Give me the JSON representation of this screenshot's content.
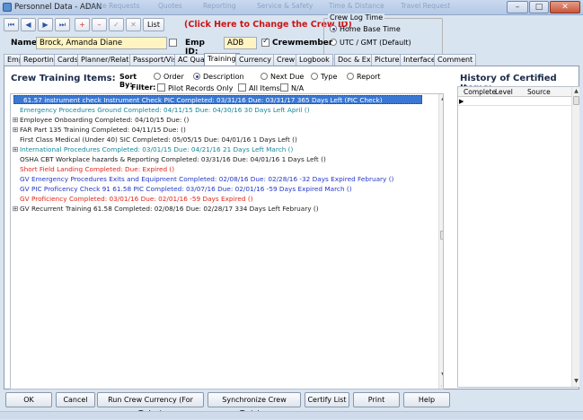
{
  "window": {
    "title": "Personnel Data - ADAN",
    "background_tabs": [
      "Quote Requests",
      "Quotes",
      "Reporting",
      "Service & Safety",
      "Time & Distance",
      "Travel Request"
    ],
    "controls": {
      "minimize": "–",
      "maximize": "□",
      "close": "✕"
    }
  },
  "toolbar": {
    "buttons": [
      {
        "icon": "first-record-icon",
        "glyph": "⏮"
      },
      {
        "icon": "prev-record-icon",
        "glyph": "◀"
      },
      {
        "icon": "next-record-icon",
        "glyph": "▶"
      },
      {
        "icon": "last-record-icon",
        "glyph": "⏭"
      },
      {
        "icon": "add-record-icon",
        "glyph": "+"
      },
      {
        "icon": "delete-record-icon",
        "glyph": "–"
      },
      {
        "icon": "save-record-icon",
        "glyph": "✓"
      },
      {
        "icon": "cancel-edit-icon",
        "glyph": "✕"
      }
    ],
    "list_label": "List",
    "crew_link": "(Click Here to Change the Crew ID)"
  },
  "crew_log_time": {
    "legend": "Crew Log Time",
    "options": [
      "Home Base Time",
      "UTC / GMT (Default)"
    ],
    "selected": 0
  },
  "person": {
    "name_label": "Name:",
    "name_value": "Brock, Amanda Diane",
    "emp_id_label": "Emp ID:",
    "emp_id_value": "ADB",
    "crewmember_label": "Crewmember",
    "crewmember_checked": true
  },
  "tabs": [
    "Emp",
    "Reporting",
    "Cards",
    "Planner/Relatives",
    "Passport/Visa",
    "AC Qual",
    "Training",
    "Currency",
    "Crew",
    "Logbook",
    "Doc & Exp",
    "Picture",
    "Interface",
    "Comment"
  ],
  "active_tab": "Training",
  "training": {
    "title": "Crew Training Items:",
    "sort_by_label": "Sort By:",
    "sort_options": [
      "Order",
      "Description",
      "Next Due",
      "Type",
      "Report"
    ],
    "sort_selected": 1,
    "filter_label": "Filter:",
    "filter_options": [
      "Pilot Records Only",
      "All Items",
      "N/A"
    ],
    "items": [
      {
        "text": "61.57 instrument check  Instrument Check  PIC  Completed: 03/31/16  Due: 03/31/17  365 Days Left      (PIC Check)",
        "color": "selected",
        "expandable": false
      },
      {
        "text": "Emergency Procedures Ground     Completed: 04/11/15  Due: 04/30/16  30 Days Left  April   ()",
        "color": "teal",
        "expandable": false
      },
      {
        "text": "Employee Onboarding    Completed: 04/10/15  Due:         ()",
        "color": "black",
        "expandable": true
      },
      {
        "text": "FAR Part 135 Training    Completed: 04/11/15  Due:         ()",
        "color": "black",
        "expandable": true
      },
      {
        "text": "First Class Medical  (Under 40)  SIC  Completed: 05/05/15  Due: 04/01/16  1 Days Left    ()",
        "color": "black",
        "expandable": false
      },
      {
        "text": "International Procedures     Completed: 03/01/15  Due: 04/21/16  21 Days Left  March   ()",
        "color": "teal",
        "expandable": true
      },
      {
        "text": "OSHA CBT  Workplace hazards & Reporting   Completed: 03/31/16  Due: 04/01/16  1 Days Left    ()",
        "color": "black",
        "expandable": false
      },
      {
        "text": "Short Field Landing     Completed:   Due:   Expired     ()",
        "color": "red",
        "expandable": false
      },
      {
        "text": "GV Emergency Procedures  Exits and Equipment    Completed: 02/08/16  Due: 02/28/16  -32 Days Expired  February   ()",
        "color": "blue",
        "expandable": false
      },
      {
        "text": "GV PIC Proficency Check 91  61.58  PIC  Completed: 03/07/16  Due: 02/01/16  -59 Days Expired  March   ()",
        "color": "blue",
        "expandable": false
      },
      {
        "text": "GV Proficiency    Completed: 03/01/16  Due: 02/01/16  -59 Days Expired     ()",
        "color": "red",
        "expandable": false
      },
      {
        "text": "GV Recurrent Training  61.58   Completed: 02/08/16  Due: 02/28/17  334 Days Left  February    ()",
        "color": "black",
        "expandable": true
      }
    ]
  },
  "history": {
    "title": "History of Certified Items:",
    "columns": [
      "Complete",
      "Level",
      "Source"
    ],
    "current_row_marker": "▶"
  },
  "bottom_buttons": [
    "OK",
    "Cancel",
    "Run Crew Currency (For Today)",
    "Synchronize Crew Training",
    "Certify List",
    "Print",
    "Help"
  ],
  "colors": {
    "selected": "#3a78d4",
    "teal": "#16869b",
    "red": "#e0281b",
    "blue": "#2438c4",
    "black": "#222222",
    "link_red": "#cc1414",
    "field_yellow": "#fff4c2"
  }
}
